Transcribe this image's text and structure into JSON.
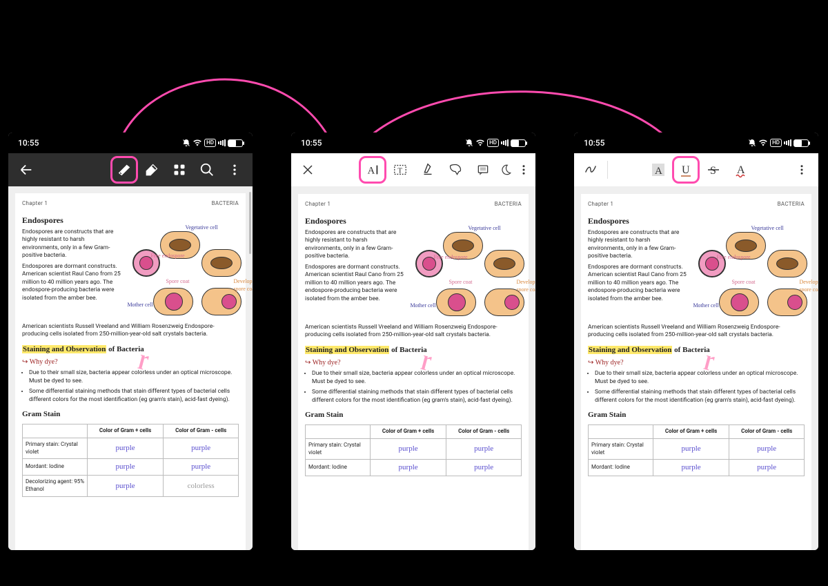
{
  "status": {
    "time": "10:55",
    "hd": "HD"
  },
  "doc": {
    "chapter": "Chapter 1",
    "topic": "BACTERIA",
    "h1": "Endospores",
    "para1": "Endospores are constructs that are highly resistant to harsh environments, only in a few Gram-positive bacteria.",
    "para2": "Endospores are dormant constructs. American scientist Raul Cano from 25 million to 40 million years ago. The endospore-producing bacteria were isolated from the amber bee.",
    "para3": "American scientists Russell Vreeland and William Rosenzweig Endospore-producing cells isolated from 250-million-year-old salt crystals bacteria.",
    "h2_hl": "Staining and Observation",
    "h2_rest": " of Bacteria",
    "why": "Why dye?",
    "b1": "Due to their small size, bacteria appear colorless under an optical microscope. Must be dyed to see.",
    "b2": "Some differential staining methods that stain different types of bacterial cells different colors for the most identification (eg gram's stain), acid-fast dyeing).",
    "h3": "Gram Stain",
    "th_plus": "Color of Gram + cells",
    "th_minus": "Color of Gram - cells",
    "r1": "Primary stain: Crystal violet",
    "r2": "Mordant: Iodine",
    "r3": "Decolorizing agent: 95% Ethanol",
    "purple": "purple",
    "colorless": "colorless",
    "diag": {
      "veg": "Vegetative cell",
      "free": "Free endospore",
      "spore": "Spore coat",
      "dev": "Developing spore coat",
      "mother": "Mother cell"
    }
  },
  "icons": {
    "back": "back-arrow",
    "eraser": "eraser",
    "edit": "edit",
    "grid": "grid",
    "search": "search",
    "more": "more",
    "close": "close",
    "highlight_a": "highlight-A",
    "textbox": "text-box",
    "highlighter": "highlighter-pen",
    "lasso": "lasso",
    "comment": "comment",
    "moon": "night",
    "pen": "freehand",
    "box_a": "boxed-A",
    "underline": "U",
    "strike": "strikethrough",
    "font_a": "font-A"
  }
}
